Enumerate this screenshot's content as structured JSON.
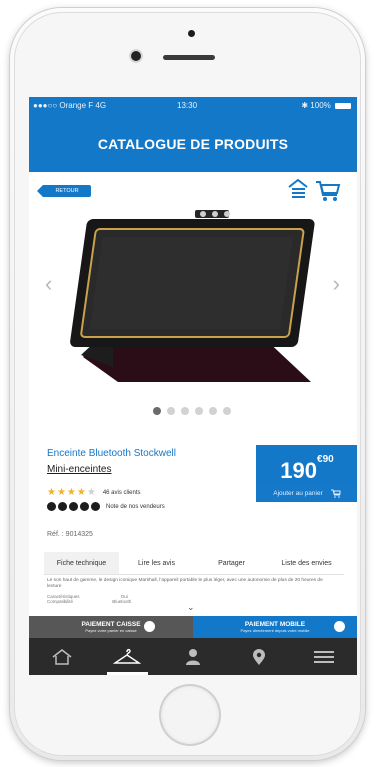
{
  "status_bar": {
    "carrier": "●●●○○ Orange F  4G",
    "time": "13:30",
    "battery": "100%"
  },
  "header": {
    "title": "CATALOGUE DE PRODUITS"
  },
  "back_button": "RETOUR",
  "product": {
    "name": "Enceinte Bluetooth Stockwell",
    "category": "Mini-enceintes",
    "reviews_text": "46 avis clients",
    "rating_stars": 4,
    "seller_rating_text": "Note de nos vendeurs",
    "ref": "Réf. : 9014325",
    "price_main": "190",
    "price_cents": "€90",
    "add_to_cart": "Ajouter au panier",
    "image_dots_total": 6,
    "image_dots_active": 0
  },
  "tabs": {
    "fiche": "Fiche technique",
    "avis": "Lire les avis",
    "partager": "Partager",
    "envies": "Liste des envies"
  },
  "tab_content": {
    "description": "Le son haut de gamme, le design iconique Marshall, l’appareil portable le plus léger, avec une autonomie de plus de 20 heures de lecture",
    "rows": [
      {
        "label": "Caractéristiques",
        "value": "Oui"
      },
      {
        "label": "Compatibilité",
        "value": "Bluetooth"
      }
    ]
  },
  "pay": {
    "caisse_title": "PAIEMENT CAISSE",
    "caisse_sub": "Payez votre panier en caisse",
    "mobile_title": "PAIEMENT MOBILE",
    "mobile_sub": "Payez directement depuis votre mobile"
  },
  "colors": {
    "primary": "#1478c8",
    "dark": "#2b2b2b",
    "star": "#f3b320"
  }
}
